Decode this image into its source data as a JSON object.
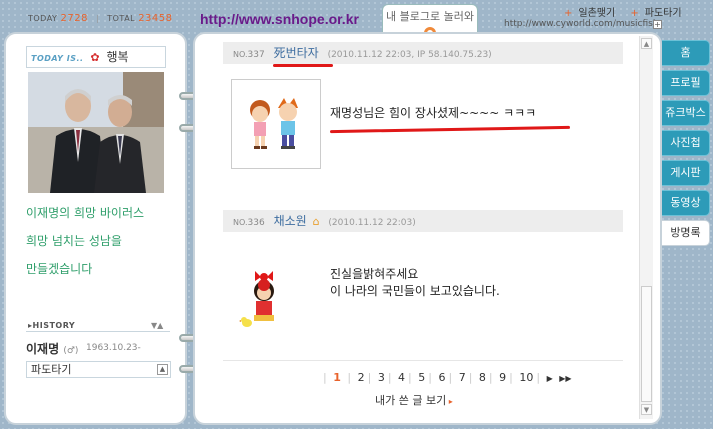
{
  "header": {
    "today_label": "TODAY",
    "today_count": "2728",
    "total_label": "TOTAL",
    "total_count": "23458",
    "site_url": "http://www.snhope.or.kr",
    "blog_tab_label": "내 블로그로 놀러와",
    "link_ilchon": "일촌맺기",
    "link_pandogi": "파도타기",
    "home_url": "http://www.cyworld.com/musicfish"
  },
  "left": {
    "today_is_label": "TODAY IS..",
    "mood": "행복",
    "profile_lines": [
      "이재명의 희망 바이러스",
      "희망 넘치는 성남을",
      "만들겠습니다"
    ],
    "history_label": "HISTORY",
    "name": "이재명",
    "gender_icon": "male-icon",
    "birth": "1963.10.23-",
    "wave_label": "파도타기"
  },
  "posts": [
    {
      "no_label": "NO.",
      "no": "337",
      "nick": "死번타자",
      "meta": "(2010.11.12 22:03, IP 58.140.75.23)",
      "message": [
        "재명성님은 힘이 장사셨제~~~~ ㅋㅋㅋ"
      ]
    },
    {
      "no_label": "NO.",
      "no": "336",
      "nick": "채소원",
      "meta": "(2010.11.12 22:03)",
      "message": [
        "진실을밝혀주세요",
        "이 나라의 국민들이 보고있습니다."
      ]
    }
  ],
  "pager": {
    "current": "1",
    "pages": [
      "2",
      "3",
      "4",
      "5",
      "6",
      "7",
      "8",
      "9",
      "10"
    ],
    "next": "▶",
    "last": "▶▶"
  },
  "my_posts_link": "내가 쓴 글 보기",
  "tabs": [
    "홈",
    "프로필",
    "쥬크박스",
    "사진첩",
    "게시판",
    "동영상",
    "방명록"
  ],
  "active_tab": "방명록",
  "colors": {
    "accent": "#e8632c",
    "tab_bg": "#2d9bb8",
    "annotation_red": "#e01818",
    "profile_text": "#2e9e6a"
  }
}
